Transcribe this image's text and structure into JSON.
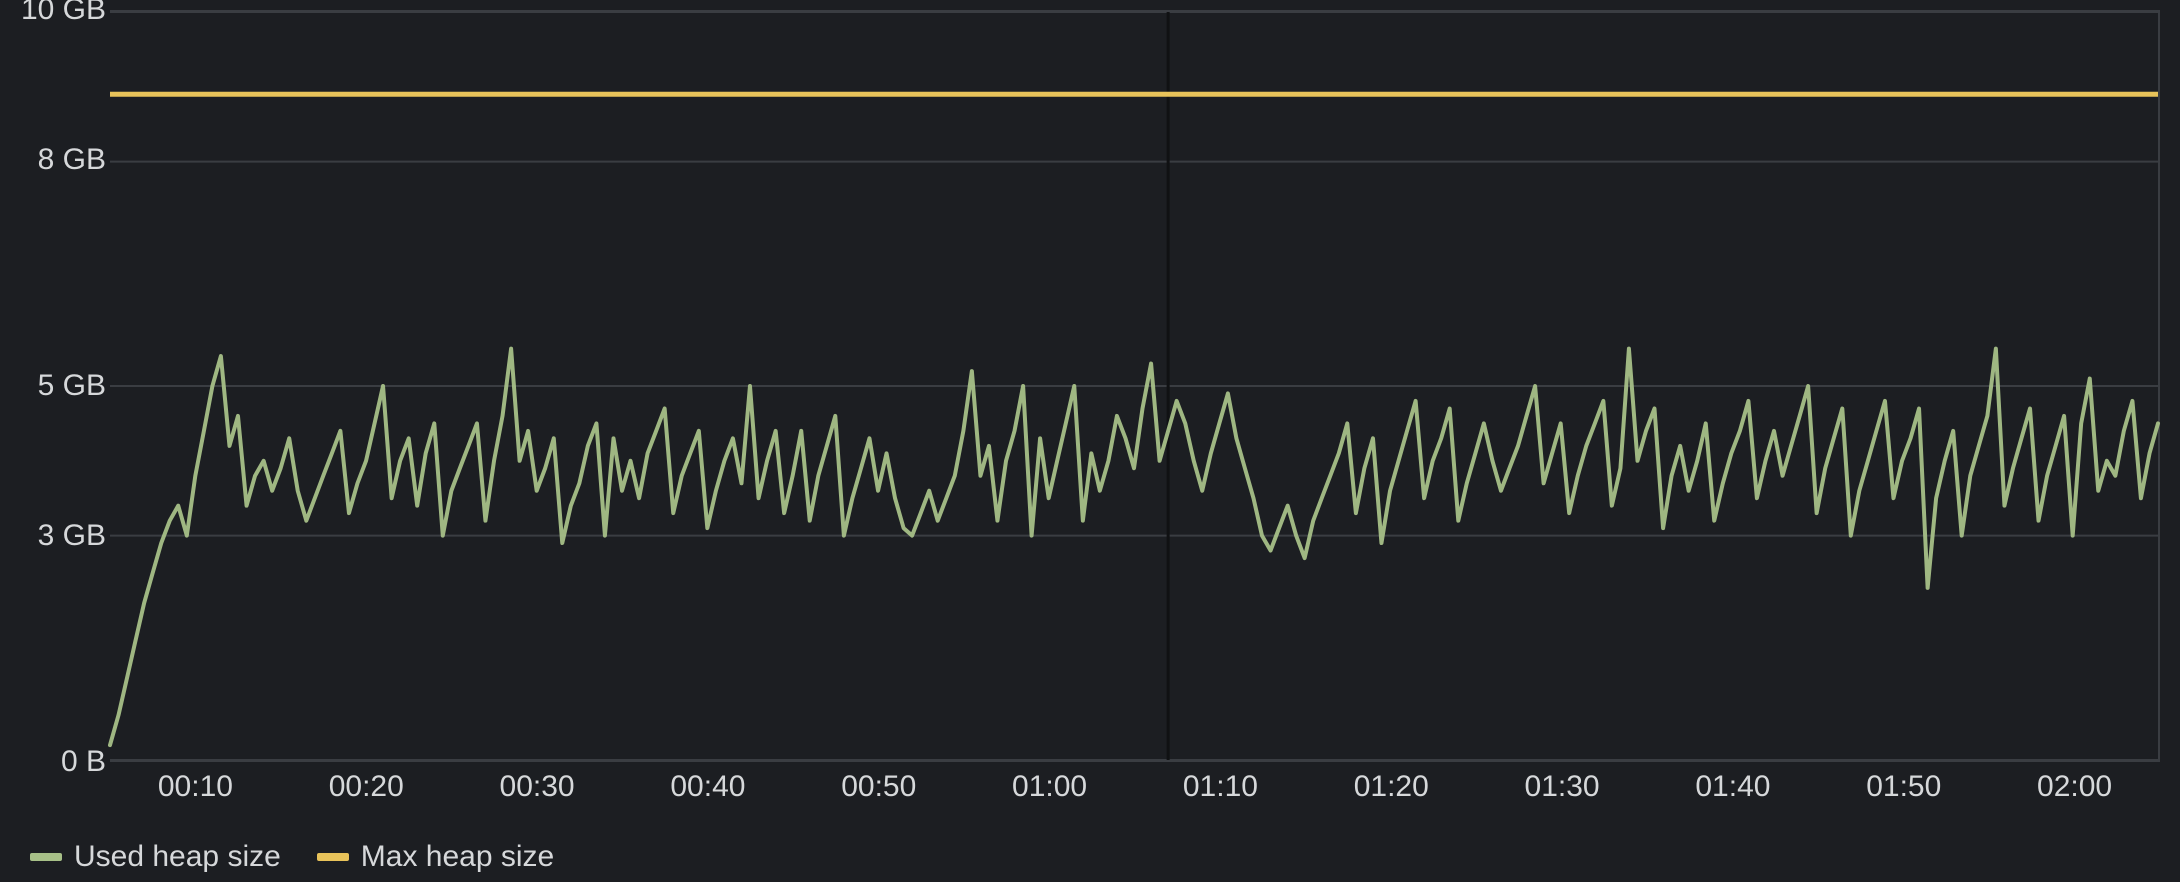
{
  "chart_data": {
    "type": "line",
    "xlabel": "",
    "ylabel": "",
    "ylim": [
      0,
      10
    ],
    "y_unit": "GB",
    "y_ticks": [
      {
        "v": 0,
        "label": "0 B"
      },
      {
        "v": 3,
        "label": "3 GB"
      },
      {
        "v": 5,
        "label": "5 GB"
      },
      {
        "v": 8,
        "label": "8 GB"
      },
      {
        "v": 10,
        "label": "10 GB"
      }
    ],
    "x_ticks": [
      "00:10",
      "00:20",
      "00:30",
      "00:40",
      "00:50",
      "01:00",
      "01:10",
      "01:20",
      "01:30",
      "01:40",
      "01:50",
      "02:00"
    ],
    "x_range_minutes": [
      5,
      125
    ],
    "cursor_x_minute": 67,
    "series": [
      {
        "name": "Used heap size",
        "color": "#a7c088",
        "x_minutes": [
          5,
          5.5,
          6,
          6.5,
          7,
          7.5,
          8,
          8.5,
          9,
          9.5,
          10,
          10.5,
          11,
          11.5,
          12,
          12.5,
          13,
          13.5,
          14,
          14.5,
          15,
          15.5,
          16,
          16.5,
          17,
          17.5,
          18,
          18.5,
          19,
          19.5,
          20,
          20.5,
          21,
          21.5,
          22,
          22.5,
          23,
          23.5,
          24,
          24.5,
          25,
          25.5,
          26,
          26.5,
          27,
          27.5,
          28,
          28.5,
          29,
          29.5,
          30,
          30.5,
          31,
          31.5,
          32,
          32.5,
          33,
          33.5,
          34,
          34.5,
          35,
          35.5,
          36,
          36.5,
          37,
          37.5,
          38,
          38.5,
          39,
          39.5,
          40,
          40.5,
          41,
          41.5,
          42,
          42.5,
          43,
          43.5,
          44,
          44.5,
          45,
          45.5,
          46,
          46.5,
          47,
          47.5,
          48,
          48.5,
          49,
          49.5,
          50,
          50.5,
          51,
          51.5,
          52,
          52.5,
          53,
          53.5,
          54,
          54.5,
          55,
          55.5,
          56,
          56.5,
          57,
          57.5,
          58,
          58.5,
          59,
          59.5,
          60,
          60.5,
          61,
          61.5,
          62,
          62.5,
          63,
          63.5,
          64,
          64.5,
          65,
          65.5,
          66,
          66.5,
          67,
          67.5,
          68,
          68.5,
          69,
          69.5,
          70,
          70.5,
          71,
          71.5,
          72,
          72.5,
          73,
          73.5,
          74,
          74.5,
          75,
          75.5,
          76,
          76.5,
          77,
          77.5,
          78,
          78.5,
          79,
          79.5,
          80,
          80.5,
          81,
          81.5,
          82,
          82.5,
          83,
          83.5,
          84,
          84.5,
          85,
          85.5,
          86,
          86.5,
          87,
          87.5,
          88,
          88.5,
          89,
          89.5,
          90,
          90.5,
          91,
          91.5,
          92,
          92.5,
          93,
          93.5,
          94,
          94.5,
          95,
          95.5,
          96,
          96.5,
          97,
          97.5,
          98,
          98.5,
          99,
          99.5,
          100,
          100.5,
          101,
          101.5,
          102,
          102.5,
          103,
          103.5,
          104,
          104.5,
          105,
          105.5,
          106,
          106.5,
          107,
          107.5,
          108,
          108.5,
          109,
          109.5,
          110,
          110.5,
          111,
          111.5,
          112,
          112.5,
          113,
          113.5,
          114,
          114.5,
          115,
          115.5,
          116,
          116.5,
          117,
          117.5,
          118,
          118.5,
          119,
          119.5,
          120,
          120.5,
          121,
          121.5,
          122,
          122.5,
          123,
          123.5,
          124,
          124.5,
          125
        ],
        "values_gb": [
          0.2,
          0.6,
          1.1,
          1.6,
          2.1,
          2.5,
          2.9,
          3.2,
          3.4,
          3.0,
          3.8,
          4.4,
          5.0,
          5.4,
          4.2,
          4.6,
          3.4,
          3.8,
          4.0,
          3.6,
          3.9,
          4.3,
          3.6,
          3.2,
          3.5,
          3.8,
          4.1,
          4.4,
          3.3,
          3.7,
          4.0,
          4.5,
          5.0,
          3.5,
          4.0,
          4.3,
          3.4,
          4.1,
          4.5,
          3.0,
          3.6,
          3.9,
          4.2,
          4.5,
          3.2,
          4.0,
          4.6,
          5.5,
          4.0,
          4.4,
          3.6,
          3.9,
          4.3,
          2.9,
          3.4,
          3.7,
          4.2,
          4.5,
          3.0,
          4.3,
          3.6,
          4.0,
          3.5,
          4.1,
          4.4,
          4.7,
          3.3,
          3.8,
          4.1,
          4.4,
          3.1,
          3.6,
          4.0,
          4.3,
          3.7,
          5.0,
          3.5,
          4.0,
          4.4,
          3.3,
          3.8,
          4.4,
          3.2,
          3.8,
          4.2,
          4.6,
          3.0,
          3.5,
          3.9,
          4.3,
          3.6,
          4.1,
          3.5,
          3.1,
          3.0,
          3.3,
          3.6,
          3.2,
          3.5,
          3.8,
          4.4,
          5.2,
          3.8,
          4.2,
          3.2,
          4.0,
          4.4,
          5.0,
          3.0,
          4.3,
          3.5,
          4.0,
          4.5,
          5.0,
          3.2,
          4.1,
          3.6,
          4.0,
          4.6,
          4.3,
          3.9,
          4.7,
          5.3,
          4.0,
          4.4,
          4.8,
          4.5,
          4.0,
          3.6,
          4.1,
          4.5,
          4.9,
          4.3,
          3.9,
          3.5,
          3.0,
          2.8,
          3.1,
          3.4,
          3.0,
          2.7,
          3.2,
          3.5,
          3.8,
          4.1,
          4.5,
          3.3,
          3.9,
          4.3,
          2.9,
          3.6,
          4.0,
          4.4,
          4.8,
          3.5,
          4.0,
          4.3,
          4.7,
          3.2,
          3.7,
          4.1,
          4.5,
          4.0,
          3.6,
          3.9,
          4.2,
          4.6,
          5.0,
          3.7,
          4.1,
          4.5,
          3.3,
          3.8,
          4.2,
          4.5,
          4.8,
          3.4,
          3.9,
          5.5,
          4.0,
          4.4,
          4.7,
          3.1,
          3.8,
          4.2,
          3.6,
          4.0,
          4.5,
          3.2,
          3.7,
          4.1,
          4.4,
          4.8,
          3.5,
          4.0,
          4.4,
          3.8,
          4.2,
          4.6,
          5.0,
          3.3,
          3.9,
          4.3,
          4.7,
          3.0,
          3.6,
          4.0,
          4.4,
          4.8,
          3.5,
          4.0,
          4.3,
          4.7,
          2.3,
          3.5,
          4.0,
          4.4,
          3.0,
          3.8,
          4.2,
          4.6,
          5.5,
          3.4,
          3.9,
          4.3,
          4.7,
          3.2,
          3.8,
          4.2,
          4.6,
          3.0,
          4.5,
          5.1,
          3.6,
          4.0,
          3.8,
          4.4,
          4.8,
          3.5,
          4.1,
          4.5
        ]
      },
      {
        "name": "Max heap size",
        "color": "#e8c35a",
        "x_minutes": [
          5,
          125
        ],
        "values_gb": [
          8.9,
          8.9
        ]
      }
    ]
  },
  "legend": {
    "items": [
      {
        "label": "Used heap size",
        "color": "#a7c088"
      },
      {
        "label": "Max heap size",
        "color": "#e8c35a"
      }
    ]
  }
}
